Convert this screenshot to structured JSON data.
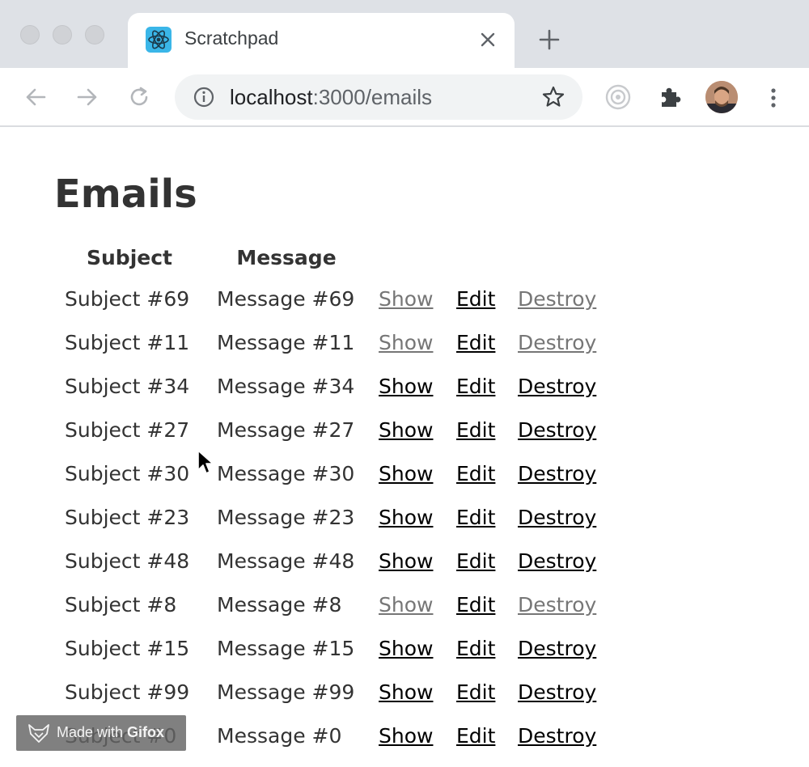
{
  "browser": {
    "tab": {
      "title": "Scratchpad",
      "favicon": "react-icon"
    },
    "url": {
      "host": "localhost",
      "rest": ":3000/emails"
    },
    "colors": {
      "tabstrip": "#dee1e6",
      "favicon_bg": "#3ab6e8"
    }
  },
  "page": {
    "heading": "Emails",
    "table": {
      "headers": [
        "Subject",
        "Message",
        "",
        "",
        ""
      ],
      "rows": [
        {
          "subject": "Subject #69",
          "message": "Message #69",
          "show": "Show",
          "edit": "Edit",
          "destroy": "Destroy"
        },
        {
          "subject": "Subject #11",
          "message": "Message #11",
          "show": "Show",
          "edit": "Edit",
          "destroy": "Destroy"
        },
        {
          "subject": "Subject #34",
          "message": "Message #34",
          "show": "Show",
          "edit": "Edit",
          "destroy": "Destroy"
        },
        {
          "subject": "Subject #27",
          "message": "Message #27",
          "show": "Show",
          "edit": "Edit",
          "destroy": "Destroy"
        },
        {
          "subject": "Subject #30",
          "message": "Message #30",
          "show": "Show",
          "edit": "Edit",
          "destroy": "Destroy"
        },
        {
          "subject": "Subject #23",
          "message": "Message #23",
          "show": "Show",
          "edit": "Edit",
          "destroy": "Destroy"
        },
        {
          "subject": "Subject #48",
          "message": "Message #48",
          "show": "Show",
          "edit": "Edit",
          "destroy": "Destroy"
        },
        {
          "subject": "Subject #8",
          "message": "Message #8",
          "show": "Show",
          "edit": "Edit",
          "destroy": "Destroy"
        },
        {
          "subject": "Subject #15",
          "message": "Message #15",
          "show": "Show",
          "edit": "Edit",
          "destroy": "Destroy"
        },
        {
          "subject": "Subject #99",
          "message": "Message #99",
          "show": "Show",
          "edit": "Edit",
          "destroy": "Destroy"
        },
        {
          "subject": "Subject #0",
          "message": "Message #0",
          "show": "Show",
          "edit": "Edit",
          "destroy": "Destroy"
        }
      ],
      "visited_link_color": "#767676",
      "link_color": "#000000"
    }
  },
  "watermark": {
    "prefix": "Made with ",
    "brand": "Gifox"
  }
}
